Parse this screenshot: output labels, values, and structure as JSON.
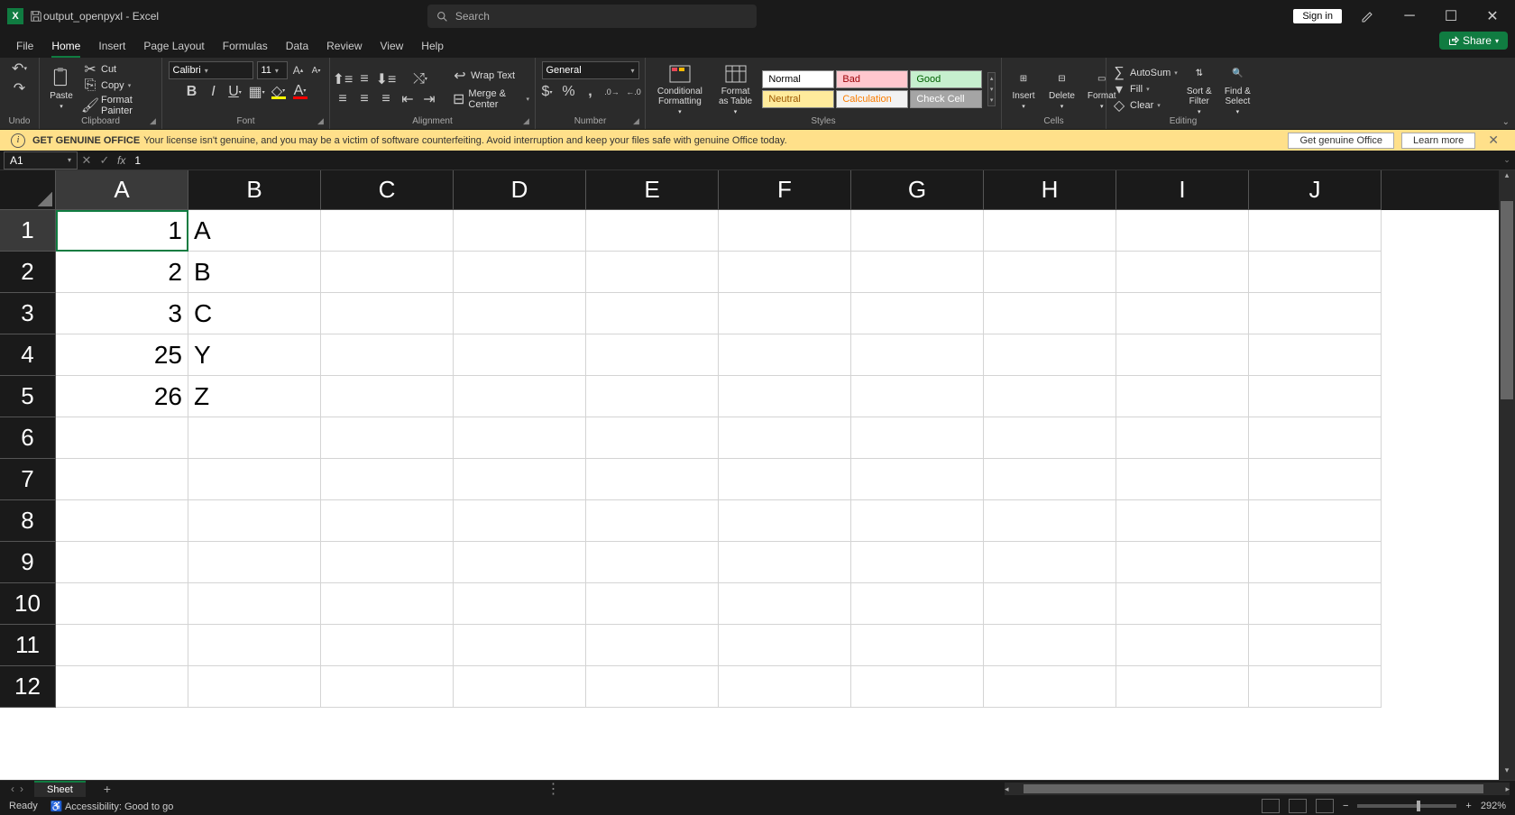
{
  "title": {
    "filename": "output_openpyxl",
    "app": "Excel"
  },
  "search_placeholder": "Search",
  "signin": "Sign in",
  "tabs": [
    "File",
    "Home",
    "Insert",
    "Page Layout",
    "Formulas",
    "Data",
    "Review",
    "View",
    "Help"
  ],
  "active_tab": "Home",
  "share": "Share",
  "ribbon": {
    "undo_group": "Undo",
    "clipboard": {
      "paste": "Paste",
      "cut": "Cut",
      "copy": "Copy",
      "painter": "Format Painter",
      "label": "Clipboard"
    },
    "font": {
      "name": "Calibri",
      "size": "11",
      "label": "Font"
    },
    "alignment": {
      "wrap": "Wrap Text",
      "merge": "Merge & Center",
      "label": "Alignment"
    },
    "number": {
      "format": "General",
      "label": "Number"
    },
    "styles": {
      "cond": "Conditional Formatting",
      "table": "Format as Table",
      "cells": [
        "Normal",
        "Bad",
        "Good",
        "Neutral",
        "Calculation",
        "Check Cell"
      ],
      "label": "Styles"
    },
    "cells_group": {
      "insert": "Insert",
      "delete": "Delete",
      "format": "Format",
      "label": "Cells"
    },
    "editing": {
      "autosum": "AutoSum",
      "fill": "Fill",
      "clear": "Clear",
      "sort": "Sort & Filter",
      "find": "Find & Select",
      "label": "Editing"
    }
  },
  "warning": {
    "title": "GET GENUINE OFFICE",
    "text": "Your license isn't genuine, and you may be a victim of software counterfeiting. Avoid interruption and keep your files safe with genuine Office today.",
    "btn1": "Get genuine Office",
    "btn2": "Learn more"
  },
  "namebox": "A1",
  "formula": "1",
  "columns": [
    "A",
    "B",
    "C",
    "D",
    "E",
    "F",
    "G",
    "H",
    "I",
    "J"
  ],
  "rows": [
    "1",
    "2",
    "3",
    "4",
    "5",
    "6",
    "7",
    "8",
    "9",
    "10",
    "11",
    "12"
  ],
  "selected_col": "A",
  "selected_row": "1",
  "data": {
    "A1": "1",
    "B1": "A",
    "A2": "2",
    "B2": "B",
    "A3": "3",
    "B3": "C",
    "A4": "25",
    "B4": "Y",
    "A5": "26",
    "B5": "Z"
  },
  "sheet": {
    "name": "Sheet"
  },
  "status": {
    "ready": "Ready",
    "access": "Accessibility: Good to go",
    "zoom": "292%"
  }
}
